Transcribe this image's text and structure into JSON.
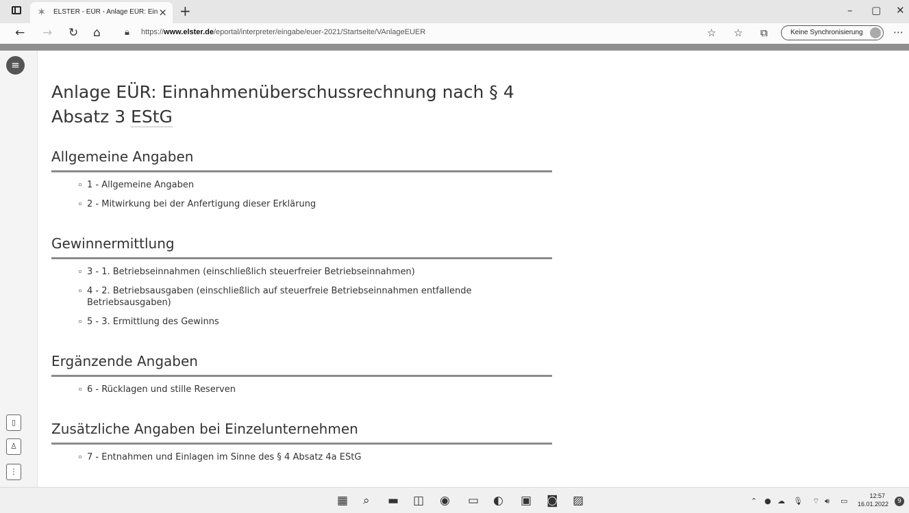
{
  "browser": {
    "tab_title": "ELSTER - EÜR - Anlage EÜR: Einn",
    "tab_close": "×",
    "new_tab": "+",
    "url_prefix": "https://",
    "url_domain": "www.elster.de",
    "url_path": "/eportal/interpreter/eingabe/euer-2021/Startseite/VAnlageEUER",
    "sync_label": "Keine Synchronisierung",
    "minimize": "–",
    "maximize": "▢",
    "close": "✕"
  },
  "page": {
    "title_line1": "Anlage EÜR: Einnahmenüberschussrechnung nach § 4",
    "title_line2_pre": "Absatz 3 ",
    "title_abbr": "EStG",
    "sections": [
      {
        "heading": "Allgemeine Angaben",
        "items": [
          "1 - Allgemeine Angaben",
          "2 - Mitwirkung bei der Anfertigung dieser Erklärung"
        ]
      },
      {
        "heading": "Gewinnermittlung",
        "items": [
          "3 - 1. Betriebseinnahmen (einschließlich steuerfreier Betriebseinnahmen)",
          "4 - 2. Betriebsausgaben (einschließlich auf steuerfreie Betriebseinnahmen entfallende Betriebsausgaben)",
          "5 - 3. Ermittlung des Gewinns"
        ]
      },
      {
        "heading": "Ergänzende Angaben",
        "items": [
          "6 - Rücklagen und stille Reserven"
        ]
      },
      {
        "heading": "Zusätzliche Angaben bei Einzelunternehmen",
        "items": [
          "7 - Entnahmen und Einlagen im Sinne des § 4 Absatz 4a EStG"
        ]
      }
    ]
  },
  "taskbar": {
    "time": "12:57",
    "date": "16.01.2022",
    "notification_count": "9"
  }
}
